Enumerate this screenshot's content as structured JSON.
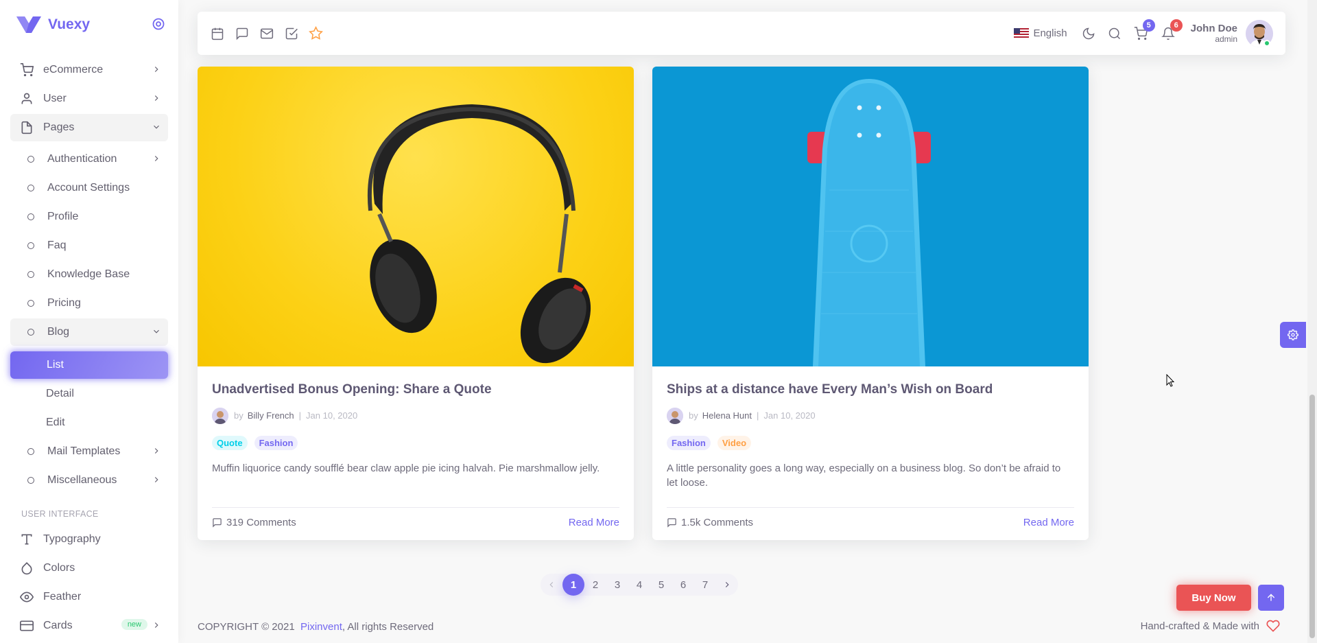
{
  "brand": {
    "name": "Vuexy",
    "color": "#7367f0"
  },
  "sidebar": {
    "items": [
      {
        "label": "eCommerce",
        "icon": "cart-icon"
      },
      {
        "label": "User",
        "icon": "user-icon"
      },
      {
        "label": "Pages",
        "icon": "file-icon"
      },
      {
        "label": "Authentication"
      },
      {
        "label": "Account Settings"
      },
      {
        "label": "Profile"
      },
      {
        "label": "Faq"
      },
      {
        "label": "Knowledge Base"
      },
      {
        "label": "Pricing"
      },
      {
        "label": "Blog"
      },
      {
        "label": "List"
      },
      {
        "label": "Detail"
      },
      {
        "label": "Edit"
      },
      {
        "label": "Mail Templates"
      },
      {
        "label": "Miscellaneous"
      }
    ],
    "section_header": "USER INTERFACE",
    "ui_items": [
      {
        "label": "Typography",
        "icon": "type-icon"
      },
      {
        "label": "Colors",
        "icon": "droplet-icon"
      },
      {
        "label": "Feather",
        "icon": "eye-icon"
      },
      {
        "label": "Cards",
        "icon": "credit-card-icon",
        "badge": "new"
      }
    ]
  },
  "navbar": {
    "language": "English",
    "cart_count": "5",
    "notification_count": "6",
    "user_name": "John Doe",
    "user_role": "admin"
  },
  "posts": [
    {
      "title": "Unadvertised Bonus Opening: Share a Quote",
      "by": "by",
      "author": "Billy French",
      "date": "Jan 10, 2020",
      "tags": [
        "Quote",
        "Fashion"
      ],
      "excerpt": "Muffin liquorice candy soufflé bear claw apple pie icing halvah. Pie marshmallow jelly.",
      "comments": "319 Comments",
      "read_more": "Read More",
      "image_bg": "#fcd116"
    },
    {
      "title": "Ships at a distance have Every Man’s Wish on Board",
      "by": "by",
      "author": "Helena Hunt",
      "date": "Jan 10, 2020",
      "tags": [
        "Fashion",
        "Video"
      ],
      "excerpt": "A little personality goes a long way, especially on a business blog. So don’t be afraid to let loose.",
      "comments": "1.5k Comments",
      "read_more": "Read More",
      "image_bg": "#0b97d4"
    }
  ],
  "pagination": {
    "pages": [
      "1",
      "2",
      "3",
      "4",
      "5",
      "6",
      "7"
    ],
    "active": "1"
  },
  "footer": {
    "copyright": "COPYRIGHT © 2021",
    "company": "Pixinvent",
    "rights": ", All rights Reserved",
    "made_with": "Hand-crafted & Made with"
  },
  "buttons": {
    "buy_now": "Buy Now"
  },
  "colors": {
    "primary": "#7367f0",
    "danger": "#ea5455",
    "success": "#28c76f",
    "info": "#00cfe8",
    "warning": "#ff9f43"
  }
}
